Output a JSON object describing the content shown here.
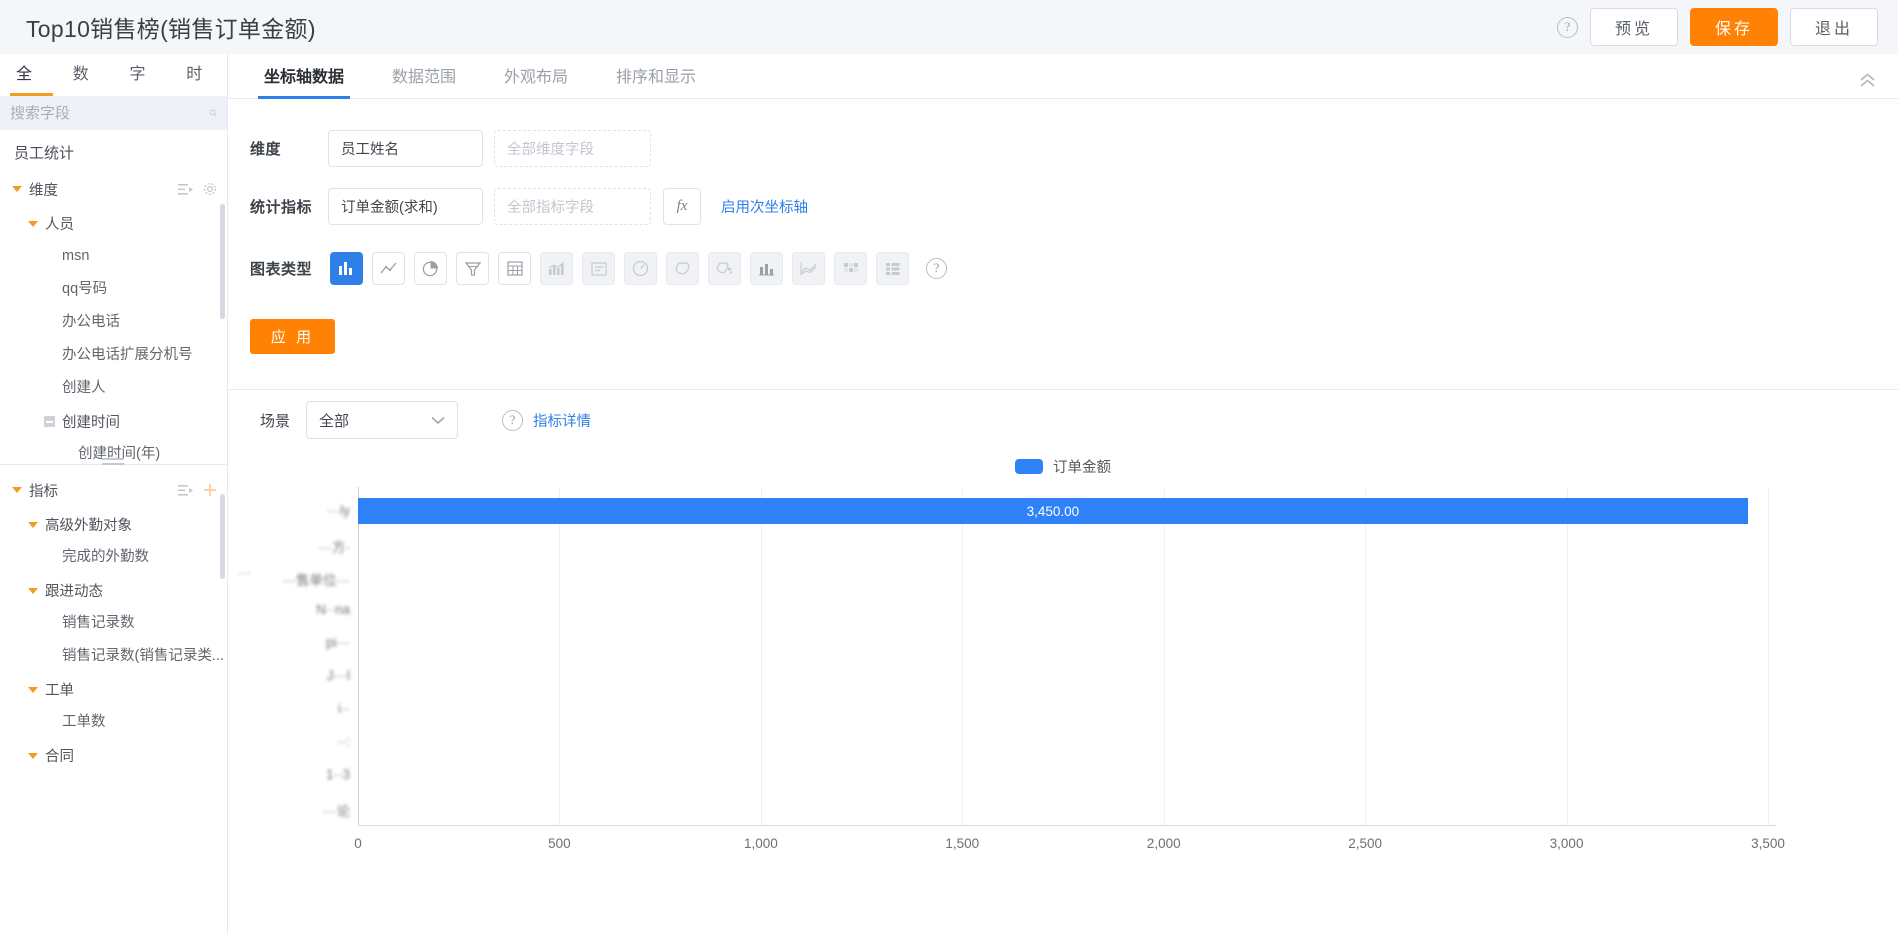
{
  "header": {
    "title": "Top10销售榜(销售订单金额)",
    "help_icon": "question-circle-icon",
    "preview_label": "预览",
    "save_label": "保存",
    "exit_label": "退出",
    "accent_orange": "#ff8204"
  },
  "sidebar": {
    "tabs": [
      {
        "label": "全部",
        "active": true
      },
      {
        "label": "数值",
        "active": false
      },
      {
        "label": "字符",
        "active": false
      },
      {
        "label": "时间",
        "active": false
      }
    ],
    "search": {
      "placeholder": "搜索字段",
      "value": "",
      "icon": "search-icon"
    },
    "dataset_name": "员工统计",
    "dimension_group": {
      "label": "维度",
      "actions": [
        "list-icon",
        "gear-icon"
      ],
      "children": [
        {
          "label": "人员",
          "items": [
            "msn",
            "qq号码",
            "办公电话",
            "办公电话扩展分机号",
            "创建人"
          ]
        }
      ],
      "collapsed_node": "创建时间",
      "collapsed_child": "创建时间(年)"
    },
    "metric_group": {
      "label": "指标",
      "actions": [
        "list-icon",
        "plus-icon"
      ],
      "children": [
        {
          "label": "高级外勤对象",
          "items": [
            "完成的外勤数"
          ]
        },
        {
          "label": "跟进动态",
          "items": [
            "销售记录数",
            "销售记录数(销售记录类..."
          ]
        },
        {
          "label": "工单",
          "items": [
            "工单数"
          ]
        },
        {
          "label": "合同",
          "items": []
        }
      ]
    }
  },
  "config": {
    "tabs": [
      {
        "label": "坐标轴数据",
        "active": true
      },
      {
        "label": "数据范围",
        "active": false
      },
      {
        "label": "外观布局",
        "active": false
      },
      {
        "label": "排序和显示",
        "active": false
      }
    ],
    "collapse_icon": "chevron-double-up-icon",
    "dimension": {
      "label": "维度",
      "value": "员工姓名",
      "placeholder": "全部维度字段"
    },
    "metric": {
      "label": "统计指标",
      "value": "订单金额(求和)",
      "placeholder": "全部指标字段",
      "fx_label": "fx",
      "secondary_axis_link": "启用次坐标轴"
    },
    "chart_type": {
      "label": "图表类型",
      "help_icon": "question-circle-icon",
      "options": [
        {
          "name": "bar-chart-icon",
          "active": true,
          "disabled": false
        },
        {
          "name": "line-chart-icon",
          "active": false,
          "disabled": false
        },
        {
          "name": "pie-chart-icon",
          "active": false,
          "disabled": false
        },
        {
          "name": "funnel-chart-icon",
          "active": false,
          "disabled": false
        },
        {
          "name": "table-icon",
          "active": false,
          "disabled": false
        },
        {
          "name": "area-chart-icon",
          "active": false,
          "disabled": true
        },
        {
          "name": "card-icon",
          "active": false,
          "disabled": true
        },
        {
          "name": "gauge-icon",
          "active": false,
          "disabled": true
        },
        {
          "name": "map-icon",
          "active": false,
          "disabled": true
        },
        {
          "name": "map-scatter-icon",
          "active": false,
          "disabled": true
        },
        {
          "name": "combo-chart-icon",
          "active": false,
          "disabled": true
        },
        {
          "name": "multi-line-chart-icon",
          "active": false,
          "disabled": true
        },
        {
          "name": "heatmap-icon",
          "active": false,
          "disabled": true
        },
        {
          "name": "detail-list-icon",
          "active": false,
          "disabled": true
        }
      ]
    },
    "apply_label": "应 用"
  },
  "scene": {
    "label": "场景",
    "value": "全部",
    "chevron_icon": "chevron-down-icon",
    "help_icon": "question-circle-icon",
    "detail_link": "指标详情"
  },
  "chart_data": {
    "type": "bar",
    "orientation": "horizontal",
    "title": "",
    "xlabel": "",
    "ylabel": "",
    "legend": [
      {
        "name": "订单金额",
        "color": "#2f81f7"
      }
    ],
    "legend_position": "top-center",
    "grid": true,
    "xlim": [
      0,
      3500
    ],
    "xticks": [
      "0",
      "500",
      "1,000",
      "1,500",
      "2,000",
      "2,500",
      "3,000",
      "3,500"
    ],
    "xtick_values": [
      0,
      500,
      1000,
      1500,
      2000,
      2500,
      3000,
      3500
    ],
    "categories": [
      "···ly",
      "···方·",
      "···售单位···",
      "N··na",
      "pi···",
      "J···l",
      "i··",
      "··:",
      "1··3",
      "···论"
    ],
    "categories_note": "y-axis category labels are visually blurred/redacted in the screenshot",
    "values": [
      3450.0,
      0,
      0,
      0,
      0,
      0,
      0,
      0,
      0,
      0
    ],
    "bar_labels": [
      "3,450.00",
      "",
      "",
      "",
      "",
      "",
      "",
      "",
      "",
      ""
    ],
    "series": [
      {
        "name": "订单金额",
        "color": "#2f81f7",
        "values": [
          3450.0,
          0,
          0,
          0,
          0,
          0,
          0,
          0,
          0,
          0
        ]
      }
    ]
  }
}
